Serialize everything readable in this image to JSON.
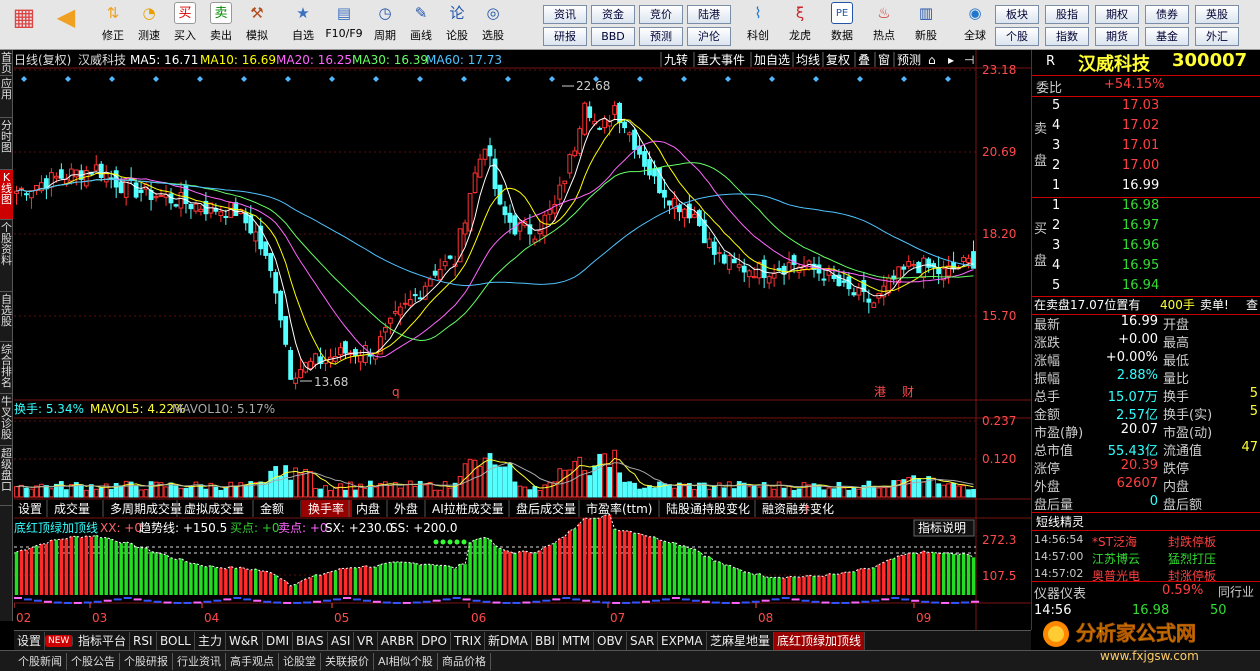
{
  "toolbar": {
    "buttons": [
      {
        "label": "",
        "icon": "grid-icon"
      },
      {
        "label": "",
        "icon": "back-arrow-icon"
      },
      {
        "label": "修正",
        "icon": "arrow-updown-icon"
      },
      {
        "label": "测速",
        "icon": "clock-icon"
      },
      {
        "label": "买入",
        "icon": "buy-icon",
        "glyph": "买"
      },
      {
        "label": "卖出",
        "icon": "sell-icon",
        "glyph": "卖"
      },
      {
        "label": "模拟",
        "icon": "hammer-icon"
      },
      {
        "label": "自选",
        "icon": "star-icon"
      },
      {
        "label": "F10/F9",
        "icon": "doc-icon"
      },
      {
        "label": "周期",
        "icon": "cycle-icon"
      },
      {
        "label": "画线",
        "icon": "pen-icon"
      },
      {
        "label": "论股",
        "icon": "chat-icon",
        "glyph": "论"
      },
      {
        "label": "选股",
        "icon": "select-icon"
      }
    ],
    "grid_buttons_left": [
      [
        "资讯",
        "资金",
        "竞价",
        "陆港"
      ],
      [
        "研报",
        "BBD",
        "预测",
        "沪伦"
      ]
    ],
    "buttons2": [
      {
        "label": "科创",
        "icon": "chart-icon"
      },
      {
        "label": "龙虎",
        "icon": "dragon-icon"
      },
      {
        "label": "数据",
        "icon": "pe-icon",
        "glyph": "PE"
      },
      {
        "label": "热点",
        "icon": "hot-icon"
      },
      {
        "label": "新股",
        "icon": "calendar-icon"
      },
      {
        "label": "全球",
        "icon": "globe-icon"
      }
    ],
    "grid_buttons_right": [
      [
        "板块",
        "股指",
        "期权",
        "债券",
        "英股"
      ],
      [
        "个股",
        "指数",
        "期货",
        "基金",
        "外汇"
      ]
    ]
  },
  "left_tabs": [
    "首页",
    "应用",
    "分时图",
    "K线图",
    "个股资料",
    "自选股",
    "综合排名",
    "牛叉诊股",
    "超级盘口"
  ],
  "chart": {
    "header": "日线(复权)",
    "stock_name": "汉威科技",
    "ma": [
      {
        "label": "MA5: 16.71",
        "color": "#ffffff"
      },
      {
        "label": "MA10: 16.69",
        "color": "#ffff00"
      },
      {
        "label": "MA20: 16.25",
        "color": "#ff66ff"
      },
      {
        "label": "MA30: 16.39",
        "color": "#66ff66"
      },
      {
        "label": "MA60: 17.73",
        "color": "#4fc3ff"
      }
    ],
    "top_menu": [
      "九转",
      "重大事件",
      "加自选",
      "均线",
      "复权",
      "叠",
      "窗",
      "预测"
    ],
    "price_axis": [
      "23.18",
      "20.69",
      "18.20",
      "15.70"
    ],
    "high_label": "22.68",
    "low_label": "13.68",
    "event_labels": [
      "q",
      "港",
      "财"
    ],
    "vol_header": [
      {
        "label": "换手: 5.34%",
        "color": "#33ffff"
      },
      {
        "label": "MAVOL5: 4.22%",
        "color": "#ffff33"
      },
      {
        "label": "MAVOL10: 5.17%",
        "color": "#aaaaaa"
      }
    ],
    "vol_axis": [
      "0.237",
      "0.120"
    ],
    "vol_tabs": [
      "设置",
      "成交量",
      "多周期成交量",
      "虚拟成交量",
      "金额",
      "换手率",
      "内盘",
      "外盘",
      "AI拉桩成交量",
      "盘后成交量",
      "市盈率(ttm)",
      "陆股通持股变化",
      "融资融券变化"
    ],
    "vol_tab_active": "换手率",
    "ind_header": [
      {
        "label": "底红顶绿加顶线",
        "color": "#33ffff"
      },
      {
        "label": "XX: +0",
        "color": "#ff6666"
      },
      {
        "label": "趋势线: +150.5",
        "color": "#ffffff"
      },
      {
        "label": "买点: +0",
        "color": "#33cc33"
      },
      {
        "label": "卖点: +0",
        "color": "#ff66ff"
      },
      {
        "label": "SX: +230.0",
        "color": "#ffffff"
      },
      {
        "label": "SS: +200.0",
        "color": "#ffffff"
      }
    ],
    "ind_button": "指标说明",
    "ind_axis": [
      "272.3",
      "107.5"
    ],
    "months": [
      "02",
      "03",
      "04",
      "05",
      "06",
      "07",
      "08",
      "09"
    ]
  },
  "right_panel": {
    "title": "汉威科技",
    "code": "300007",
    "r_label": "R",
    "weibi_label": "委比",
    "weibi": "+54.15%",
    "sell_label": [
      "卖",
      "盘"
    ],
    "buy_label": [
      "买",
      "盘"
    ],
    "asks": [
      {
        "lvl": "5",
        "price": "17.03"
      },
      {
        "lvl": "4",
        "price": "17.02"
      },
      {
        "lvl": "3",
        "price": "17.01"
      },
      {
        "lvl": "2",
        "price": "17.00"
      },
      {
        "lvl": "1",
        "price": "16.99"
      }
    ],
    "bids": [
      {
        "lvl": "1",
        "price": "16.98"
      },
      {
        "lvl": "2",
        "price": "16.97"
      },
      {
        "lvl": "3",
        "price": "16.96"
      },
      {
        "lvl": "4",
        "price": "16.95"
      },
      {
        "lvl": "5",
        "price": "16.94"
      }
    ],
    "order_note": "在卖盘17.07位置有",
    "order_qty": "400手",
    "order_tag": "卖单!",
    "order_btn": "查",
    "stats": [
      {
        "l1": "最新",
        "v1": "16.99",
        "c1": "white",
        "l2": "开盘",
        "v2": ""
      },
      {
        "l1": "涨跌",
        "v1": "+0.00",
        "c1": "white",
        "l2": "最高",
        "v2": ""
      },
      {
        "l1": "涨幅",
        "v1": "+0.00%",
        "c1": "white",
        "l2": "最低",
        "v2": ""
      },
      {
        "l1": "振幅",
        "v1": "2.88%",
        "c1": "cyan",
        "l2": "量比",
        "v2": ""
      },
      {
        "l1": "总手",
        "v1": "15.07万",
        "c1": "cyan",
        "l2": "换手",
        "v2": "5"
      },
      {
        "l1": "金额",
        "v1": "2.57亿",
        "c1": "cyan",
        "l2": "换手(实)",
        "v2": "5"
      },
      {
        "l1": "市盈(静)",
        "v1": "20.07",
        "c1": "white",
        "l2": "市盈(动)",
        "v2": ""
      },
      {
        "l1": "总市值",
        "v1": "55.43亿",
        "c1": "cyan",
        "l2": "流通值",
        "v2": "47"
      },
      {
        "l1": "涨停",
        "v1": "20.39",
        "c1": "red",
        "l2": "跌停",
        "v2": ""
      },
      {
        "l1": "外盘",
        "v1": "62607",
        "c1": "red",
        "l2": "内盘",
        "v2": ""
      },
      {
        "l1": "盘后量",
        "v1": "0",
        "c1": "cyan",
        "l2": "盘后额",
        "v2": ""
      }
    ],
    "news_title": "短线精灵",
    "news": [
      {
        "time": "14:56:54",
        "name": "*ST泛海",
        "event": "封跌停板"
      },
      {
        "time": "14:57:00",
        "name": "江苏博云",
        "event": "猛烈打压"
      },
      {
        "time": "14:57:02",
        "name": "奥普光电",
        "event": "封涨停板"
      }
    ],
    "gauge_label": "仪器仪表",
    "gauge_val": "0.59%",
    "gauge_right": "同行业",
    "tick_time": "14:56",
    "tick_price": "16.98",
    "tick_vol": "50"
  },
  "bottom_tabs": [
    "设置",
    "NEW",
    "指标平台",
    "RSI",
    "BOLL",
    "主力",
    "W&R",
    "DMI",
    "BIAS",
    "ASI",
    "VR",
    "ARBR",
    "DPO",
    "TRIX",
    "新DMA",
    "BBI",
    "MTM",
    "OBV",
    "SAR",
    "EXPMA",
    "芝麻星地量",
    "底红顶绿加顶线"
  ],
  "bottom_tab_active": "底红顶绿加顶线",
  "status_tabs": [
    "个股新闻",
    "个股公告",
    "个股研报",
    "行业资讯",
    "高手观点",
    "论股堂",
    "关联报价",
    "AI相似个股",
    "商品价格"
  ],
  "watermark": {
    "text": "分析家公式网",
    "url": "www.fxjgsw.com"
  },
  "colors": {
    "up": "#ff3232",
    "down": "#54ffff",
    "bg": "#000000",
    "grid": "#8a1a1a"
  }
}
